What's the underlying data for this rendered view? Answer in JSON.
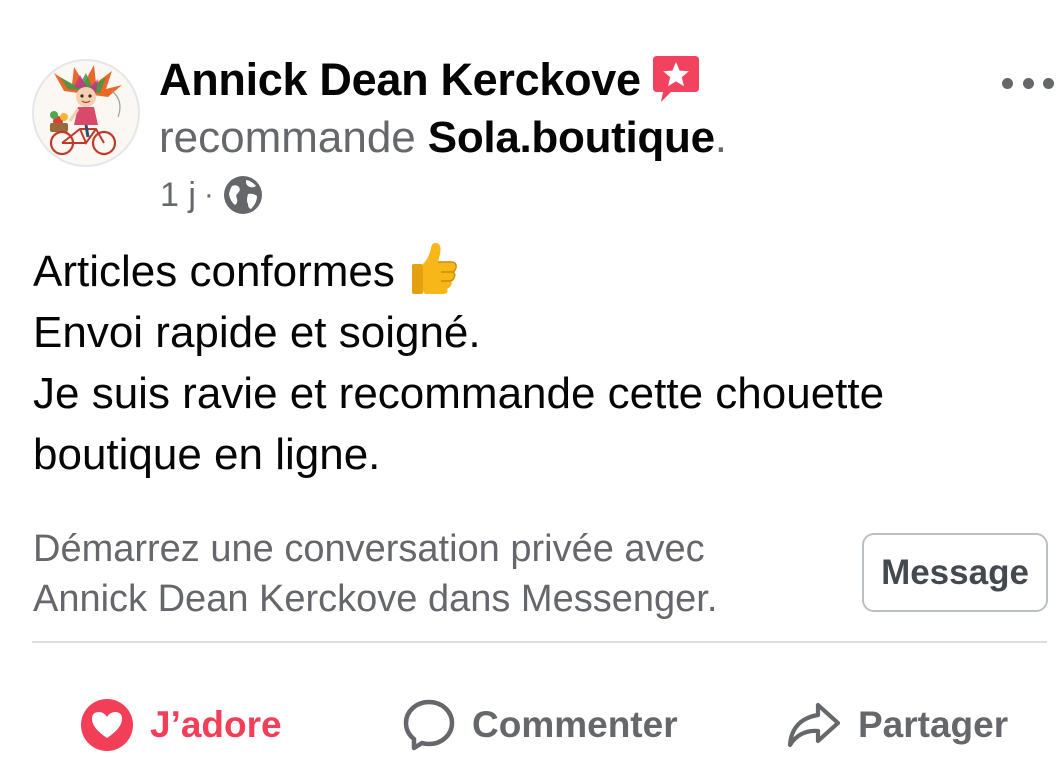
{
  "post": {
    "author": "Annick Dean Kerckove",
    "recommend_verb": "recommande",
    "page_name": "Sola.boutique",
    "page_suffix": ".",
    "time": "1 j",
    "separator": "·",
    "privacy_icon": "globe-icon",
    "badge_icon": "recommendation-star-icon",
    "text_lines": [
      "Articles conformes",
      "Envoi rapide et soigné.",
      "Je suis ravie et recommande cette chouette",
      "boutique en ligne."
    ],
    "emoji": "thumbs-up-emoji"
  },
  "messenger_cta": {
    "line1": "Démarrez une conversation privée avec",
    "line2": "Annick Dean Kerckove dans Messenger.",
    "button_label": "Message"
  },
  "actions": {
    "love_label": "J’adore",
    "comment_label": "Commenter",
    "share_label": "Partager"
  },
  "colors": {
    "love": "#f33e58",
    "secondary_text": "#65676b",
    "primary_text": "#050505",
    "badge": "#f3425f"
  }
}
